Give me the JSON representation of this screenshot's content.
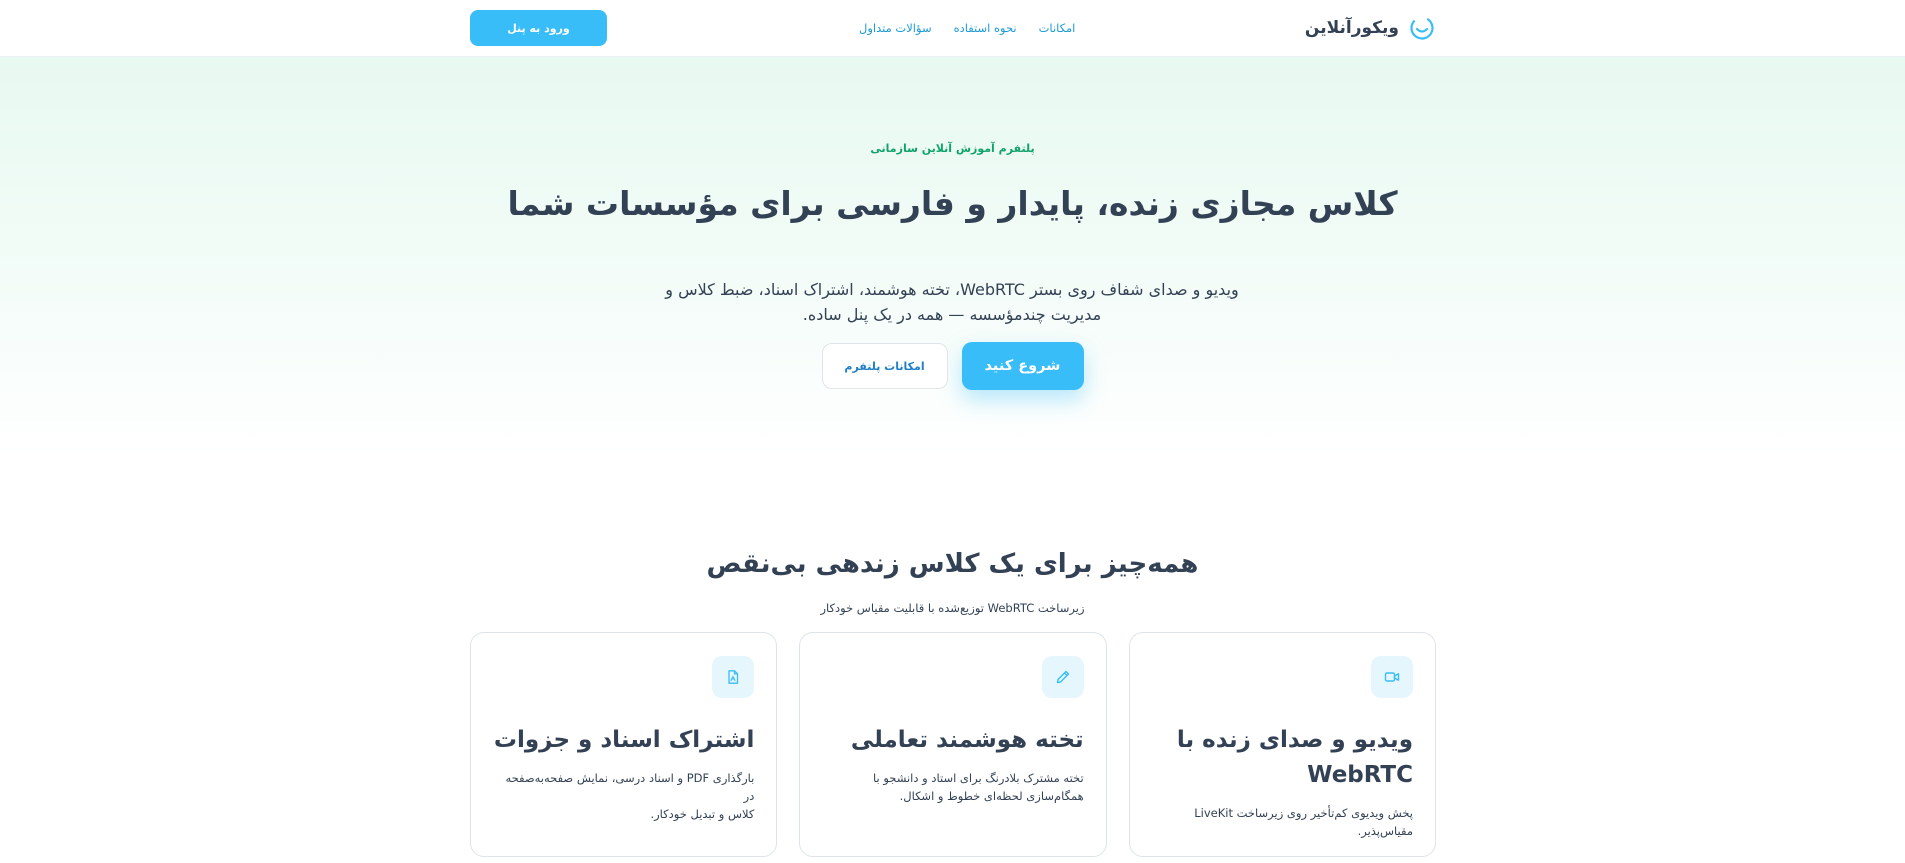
{
  "header": {
    "brand_name": "ویکورآنلاین",
    "logo_icon": "smile-circle-icon",
    "nav": [
      {
        "label": "امکانات"
      },
      {
        "label": "نحوه استفاده"
      },
      {
        "label": "سؤالات متداول"
      }
    ],
    "login_label": "ورود به پنل"
  },
  "hero": {
    "eyebrow": "پلتفرم آموزش آنلاین سازمانی",
    "title": "کلاس مجازی زنده، پایدار و فارسی برای مؤسسات شما",
    "description_line1": "ویدیو و صدای شفاف روی بستر WebRTC، تخته هوشمند، اشتراک اسناد، ضبط کلاس و",
    "description_line2": "مدیریت چندمؤسسه — همه در یک پنل ساده.",
    "primary_cta": "شروع کنید",
    "secondary_cta": "امکانات پلتفرم"
  },
  "features": {
    "title": "همه‌چیز برای یک کلاس زندهی بی‌نقص",
    "subtitle": "زیرساخت WebRTC توزیع‌شده با قابلیت مقیاس خودکار",
    "cards": [
      {
        "icon": "video-camera-icon",
        "title_line1": "ویدیو و صدای زنده با",
        "title_line2": "WebRTC",
        "desc_line1": "پخش ویدیوی کم‌تأخیر روی زیرساخت LiveKit",
        "desc_line2": "مقیاس‌پذیر."
      },
      {
        "icon": "pencil-icon",
        "title_line1": "تخته هوشمند تعاملی",
        "title_line2": "",
        "desc_line1": "تخته مشترک بلادرنگ برای استاد و دانشجو با",
        "desc_line2": "همگام‌سازی لحظه‌ای خطوط و اشکال."
      },
      {
        "icon": "pdf-document-icon",
        "title_line1": "اشتراک اسناد و جزوات",
        "title_line2": "",
        "desc_line1": "بارگذاری PDF و اسناد درسی، نمایش صفحه‌به‌صفحه در",
        "desc_line2": "کلاس و تبدیل خودکار."
      }
    ]
  },
  "colors": {
    "accent": "#38bdf8",
    "link": "#1d9bd6",
    "eyebrow": "#10a36b",
    "heading": "#334155"
  }
}
